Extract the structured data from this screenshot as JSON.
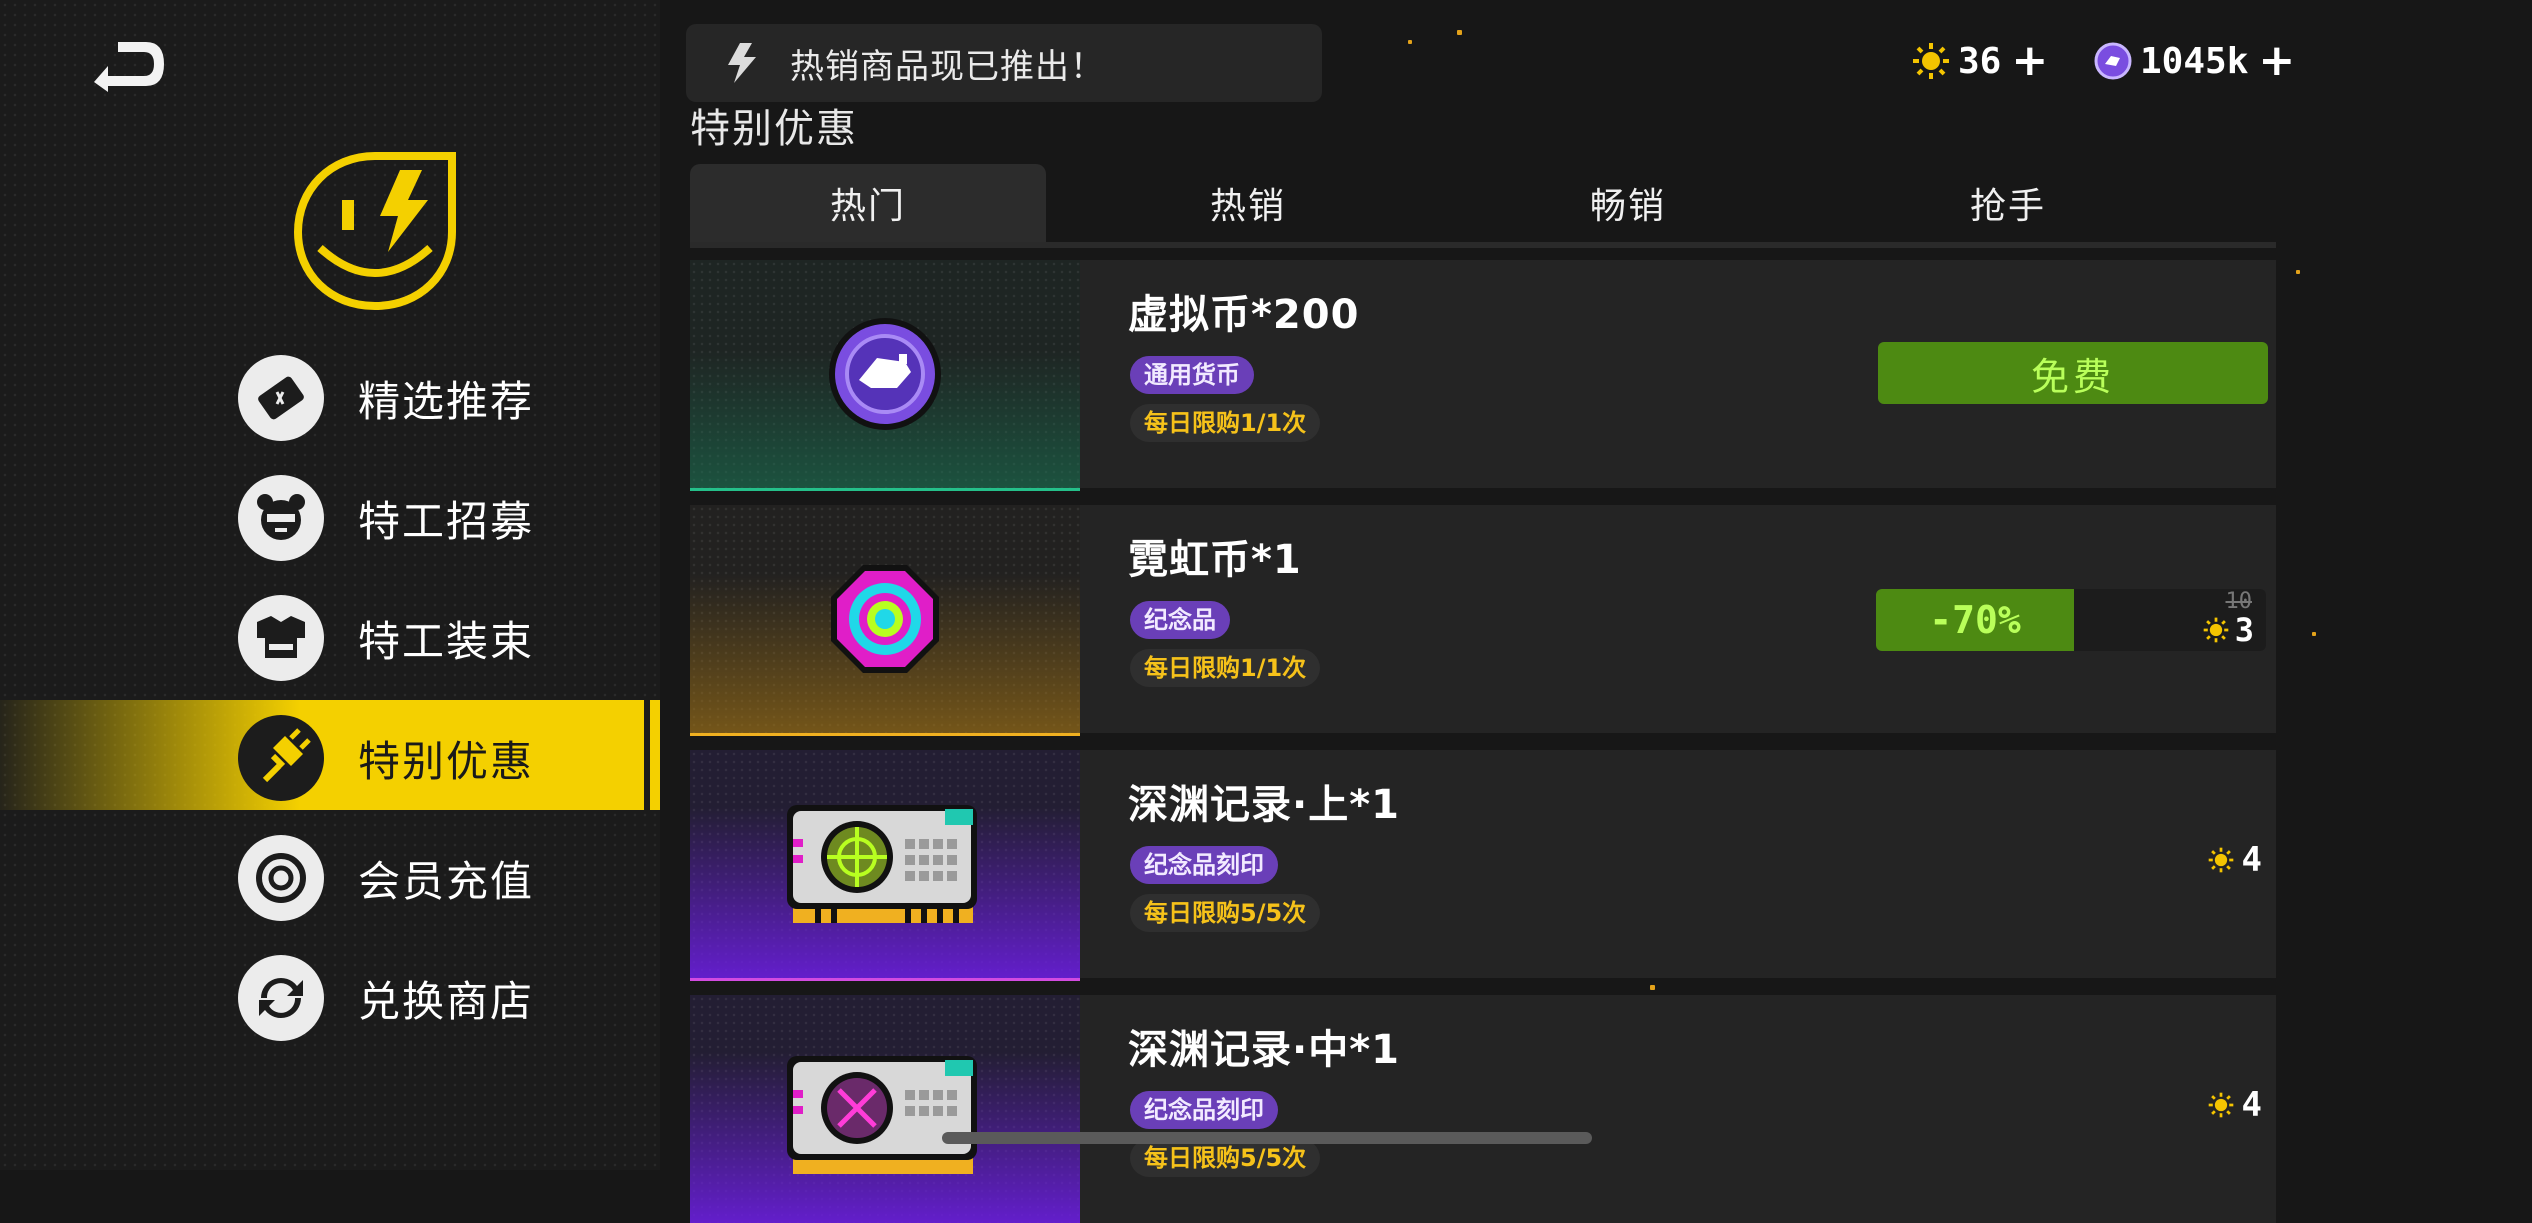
{
  "colors": {
    "accent_yellow": "#f4d000",
    "tag_purple": "#6a3fb8",
    "limit_orange": "#f6c21a",
    "free_green": "#4d8a12",
    "free_text": "#b9ff5a"
  },
  "header": {
    "notice_text": "热销商品现已推出！",
    "currencies": [
      {
        "icon": "sun-coin-icon",
        "value": "36"
      },
      {
        "icon": "purple-coin-icon",
        "value": "1045k"
      }
    ]
  },
  "sidebar": {
    "items": [
      {
        "label": "精选推荐",
        "icon": "ticket-icon",
        "active": false
      },
      {
        "label": "特工招募",
        "icon": "bear-agent-icon",
        "active": false
      },
      {
        "label": "特工装束",
        "icon": "outfit-icon",
        "active": false
      },
      {
        "label": "特别优惠",
        "icon": "plug-icon",
        "active": true
      },
      {
        "label": "会员充值",
        "icon": "target-ring-icon",
        "active": false
      },
      {
        "label": "兑换商店",
        "icon": "exchange-icon",
        "active": false
      }
    ]
  },
  "main": {
    "section_title": "特别优惠",
    "tabs": [
      {
        "label": "热门",
        "active": true
      },
      {
        "label": "热销",
        "active": false
      },
      {
        "label": "畅销",
        "active": false
      },
      {
        "label": "抢手",
        "active": false
      }
    ],
    "products": [
      {
        "title": "虚拟币*200",
        "tag": "通用货币",
        "limit": "每日限购1/1次",
        "price_label": "免费",
        "icon": "virtual-coin-icon"
      },
      {
        "title": "霓虹币*1",
        "tag": "纪念品",
        "limit": "每日限购1/1次",
        "discount": "-70%",
        "old_price": "10",
        "price": "3",
        "icon": "neon-coin-icon"
      },
      {
        "title": "深渊记录·上*1",
        "tag": "纪念品刻印",
        "limit": "每日限购5/5次",
        "price": "4",
        "icon": "abyss-record-upper-icon"
      },
      {
        "title": "深渊记录·中*1",
        "tag": "纪念品刻印",
        "limit": "每日限购5/5次",
        "price": "4",
        "icon": "abyss-record-middle-icon"
      }
    ]
  }
}
